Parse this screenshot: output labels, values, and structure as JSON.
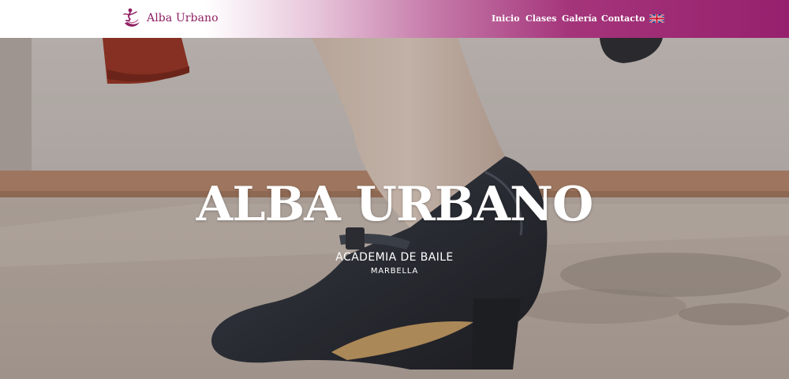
{
  "header": {
    "logo_text": "Alba Urbano",
    "logo_icon": "dancer-logo-icon",
    "nav": [
      {
        "label": "Inicio"
      },
      {
        "label": "Clases"
      },
      {
        "label": "Galería"
      },
      {
        "label": "Contacto"
      }
    ],
    "language_icon": "uk-flag-icon"
  },
  "hero": {
    "title": "ALBA URBANO",
    "subtitle": "ACADEMIA DE BAILE",
    "location": "MARBELLA"
  },
  "colors": {
    "brand": "#8e1f62",
    "header_gradient_end": "#96206d",
    "text_light": "#ffffff"
  }
}
